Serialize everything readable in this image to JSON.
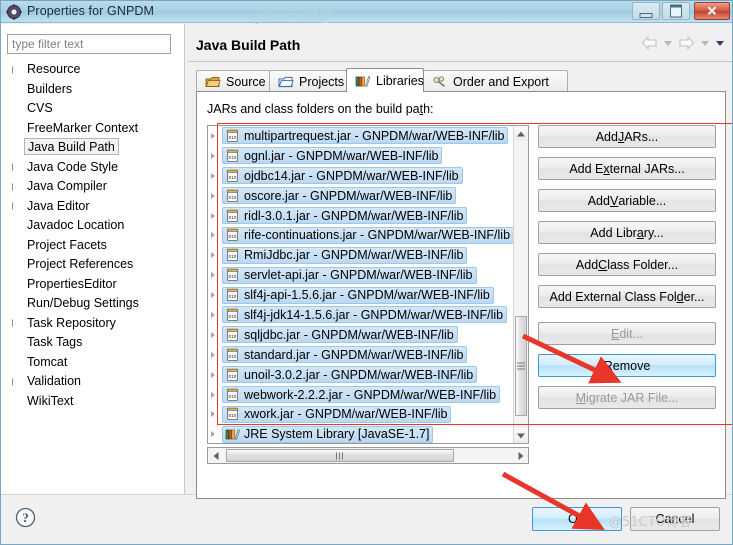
{
  "window": {
    "title": "Properties for GNPDM",
    "icon": "gear-icon",
    "minimize_label": "Minimize",
    "maximize_label": "Maximize",
    "close_label": "Close"
  },
  "sidebar": {
    "filter_placeholder": "type filter text",
    "filter_value": "",
    "items": [
      {
        "label": "Resource",
        "expandable": true,
        "selected": false
      },
      {
        "label": "Builders",
        "expandable": false,
        "selected": false
      },
      {
        "label": "CVS",
        "expandable": false,
        "selected": false
      },
      {
        "label": "FreeMarker Context",
        "expandable": false,
        "selected": false
      },
      {
        "label": "Java Build Path",
        "expandable": false,
        "selected": true
      },
      {
        "label": "Java Code Style",
        "expandable": true,
        "selected": false
      },
      {
        "label": "Java Compiler",
        "expandable": true,
        "selected": false
      },
      {
        "label": "Java Editor",
        "expandable": true,
        "selected": false
      },
      {
        "label": "Javadoc Location",
        "expandable": false,
        "selected": false
      },
      {
        "label": "Project Facets",
        "expandable": false,
        "selected": false
      },
      {
        "label": "Project References",
        "expandable": false,
        "selected": false
      },
      {
        "label": "PropertiesEditor",
        "expandable": false,
        "selected": false
      },
      {
        "label": "Run/Debug Settings",
        "expandable": false,
        "selected": false
      },
      {
        "label": "Task Repository",
        "expandable": true,
        "selected": false
      },
      {
        "label": "Task Tags",
        "expandable": false,
        "selected": false
      },
      {
        "label": "Tomcat",
        "expandable": false,
        "selected": false
      },
      {
        "label": "Validation",
        "expandable": true,
        "selected": false
      },
      {
        "label": "WikiText",
        "expandable": false,
        "selected": false
      }
    ]
  },
  "page": {
    "title": "Java Build Path",
    "back_icon": "back-arrow-icon",
    "forward_icon": "forward-arrow-icon",
    "menu_icon": "view-menu-chevron-icon"
  },
  "tabs": [
    {
      "label": "Source",
      "icon": "source-folder-icon",
      "active": false
    },
    {
      "label": "Projects",
      "icon": "projects-folder-icon",
      "active": false
    },
    {
      "label": "Libraries",
      "icon": "libraries-books-icon",
      "active": true
    },
    {
      "label": "Order and Export",
      "icon": "order-export-icon",
      "active": false
    }
  ],
  "libraries": {
    "caption_pre": "JARs and class folders on the build pa",
    "caption_mnemonic": "t",
    "caption_post": "h:",
    "entries": [
      {
        "label": "multipartrequest.jar - GNPDM/war/WEB-INF/lib",
        "icon": "jar-icon",
        "selected": true
      },
      {
        "label": "ognl.jar - GNPDM/war/WEB-INF/lib",
        "icon": "jar-icon",
        "selected": true
      },
      {
        "label": "ojdbc14.jar - GNPDM/war/WEB-INF/lib",
        "icon": "jar-icon",
        "selected": true
      },
      {
        "label": "oscore.jar - GNPDM/war/WEB-INF/lib",
        "icon": "jar-icon",
        "selected": true
      },
      {
        "label": "ridl-3.0.1.jar - GNPDM/war/WEB-INF/lib",
        "icon": "jar-icon",
        "selected": true
      },
      {
        "label": "rife-continuations.jar - GNPDM/war/WEB-INF/lib",
        "icon": "jar-icon",
        "selected": true
      },
      {
        "label": "RmiJdbc.jar - GNPDM/war/WEB-INF/lib",
        "icon": "jar-icon",
        "selected": true
      },
      {
        "label": "servlet-api.jar - GNPDM/war/WEB-INF/lib",
        "icon": "jar-icon",
        "selected": true
      },
      {
        "label": "slf4j-api-1.5.6.jar - GNPDM/war/WEB-INF/lib",
        "icon": "jar-icon",
        "selected": true
      },
      {
        "label": "slf4j-jdk14-1.5.6.jar - GNPDM/war/WEB-INF/lib",
        "icon": "jar-icon",
        "selected": true
      },
      {
        "label": "sqljdbc.jar - GNPDM/war/WEB-INF/lib",
        "icon": "jar-icon",
        "selected": true
      },
      {
        "label": "standard.jar - GNPDM/war/WEB-INF/lib",
        "icon": "jar-icon",
        "selected": true
      },
      {
        "label": "unoil-3.0.2.jar - GNPDM/war/WEB-INF/lib",
        "icon": "jar-icon",
        "selected": true
      },
      {
        "label": "webwork-2.2.2.jar - GNPDM/war/WEB-INF/lib",
        "icon": "jar-icon",
        "selected": true
      },
      {
        "label": "xwork.jar - GNPDM/war/WEB-INF/lib",
        "icon": "jar-icon",
        "selected": true
      },
      {
        "label": "JRE System Library [JavaSE-1.7]",
        "icon": "library-books-icon",
        "selected": true
      }
    ]
  },
  "buttons": [
    {
      "id": "add-jars",
      "pre": "Add ",
      "mnemonic": "J",
      "post": "ARs...",
      "state": "enabled"
    },
    {
      "id": "add-external-jars",
      "pre": "Add E",
      "mnemonic": "x",
      "post": "ternal JARs...",
      "state": "enabled"
    },
    {
      "id": "add-variable",
      "pre": "Add ",
      "mnemonic": "V",
      "post": "ariable...",
      "state": "enabled"
    },
    {
      "id": "add-library",
      "pre": "Add Libr",
      "mnemonic": "a",
      "post": "ry...",
      "state": "enabled"
    },
    {
      "id": "add-class-folder",
      "pre": "Add ",
      "mnemonic": "C",
      "post": "lass Folder...",
      "state": "enabled"
    },
    {
      "id": "add-external-class-folder",
      "pre": "Add External Class Fol",
      "mnemonic": "d",
      "post": "er...",
      "state": "enabled"
    },
    {
      "id": "edit",
      "pre": "",
      "mnemonic": "E",
      "post": "dit...",
      "state": "disabled"
    },
    {
      "id": "remove",
      "pre": "",
      "mnemonic": "R",
      "post": "emove",
      "state": "highlight"
    },
    {
      "id": "migrate-jar-file",
      "pre": "",
      "mnemonic": "M",
      "post": "igrate JAR File...",
      "state": "disabled"
    }
  ],
  "footer": {
    "help_icon": "help-question-icon",
    "ok_label": "OK",
    "cancel_label": "Cancel"
  },
  "annotations": {
    "watermark": "@51CTO博客",
    "watermark_top": "@51CTO博客",
    "highlight_color": "#e8362a",
    "accent_color": "#3c99d4"
  },
  "scrollbars": {
    "vertical_position": "bottom",
    "horizontal_position": "left"
  }
}
